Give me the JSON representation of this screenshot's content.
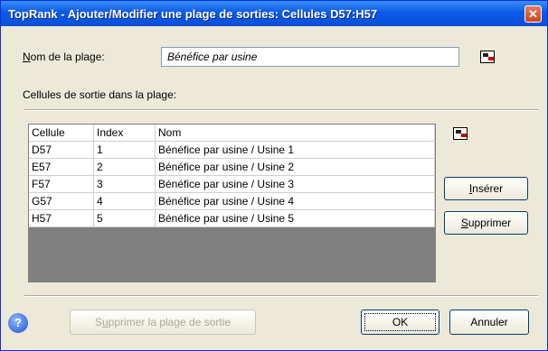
{
  "window": {
    "title": "TopRank - Ajouter/Modifier une plage de sorties: Cellules D57:H57",
    "close_glyph": "✕"
  },
  "range_name": {
    "label_access": "N",
    "label_rest": "om de la plage:",
    "value": "Bénéfice par usine"
  },
  "outputs_label": "Cellules de sortie dans la plage:",
  "table": {
    "columns": [
      "Cellule",
      "Index",
      "Nom"
    ],
    "rows": [
      {
        "cell": "D57",
        "index": "1",
        "name": "Bénéfice par usine / Usine 1"
      },
      {
        "cell": "E57",
        "index": "2",
        "name": "Bénéfice par usine / Usine 2"
      },
      {
        "cell": "F57",
        "index": "3",
        "name": "Bénéfice par usine / Usine 3"
      },
      {
        "cell": "G57",
        "index": "4",
        "name": "Bénéfice par usine / Usine 4"
      },
      {
        "cell": "H57",
        "index": "5",
        "name": "Bénéfice par usine / Usine 5"
      }
    ]
  },
  "buttons": {
    "insert_access": "I",
    "insert_rest": "nsérer",
    "delete_access": "S",
    "delete_rest": "upprimer",
    "delete_range_pre": "S",
    "delete_range_access": "u",
    "delete_range_rest": "pprimer la plage de sortie",
    "ok": "OK",
    "cancel": "Annuler",
    "help_glyph": "?"
  },
  "icons": {
    "range_select": "cell-range-select-icon",
    "grid_select": "cell-range-select-icon",
    "help": "help-icon"
  },
  "colors": {
    "titlebar": "#0b5be8",
    "dialog_bg": "#ece9d8",
    "grid_empty": "#808080"
  }
}
